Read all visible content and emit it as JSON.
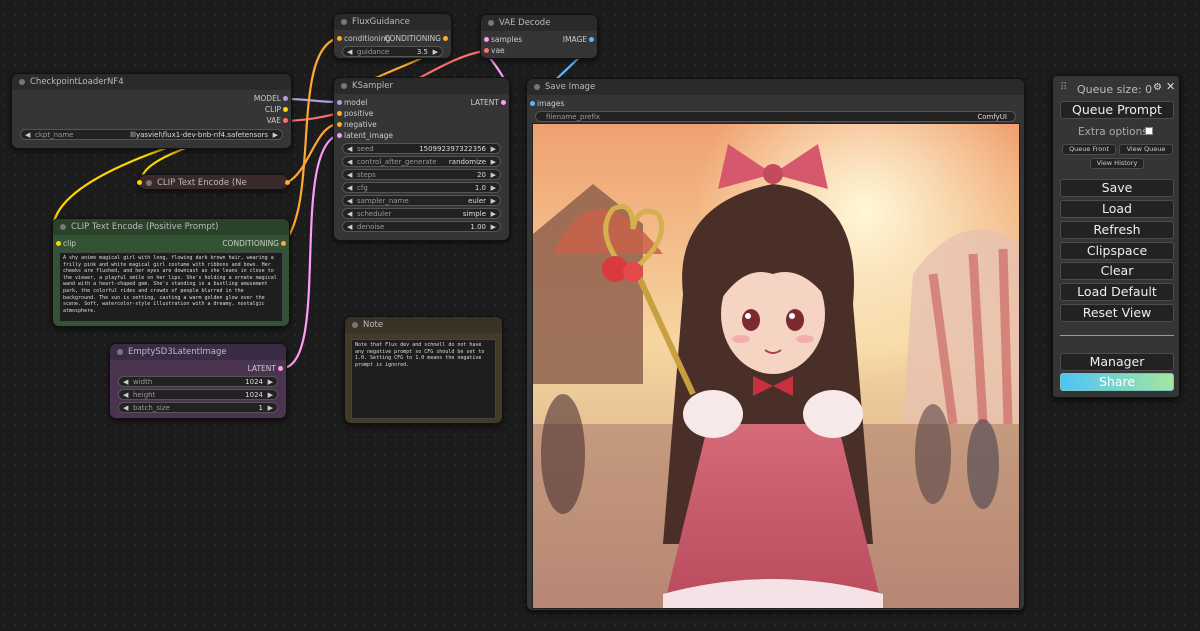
{
  "colors": {
    "model": "#b39ddb",
    "clip": "#ffd500",
    "vae": "#ff6e6e",
    "conditioning": "#ffa931",
    "latent": "#ff9cf9",
    "image": "#64b5f6",
    "share_gradient_start": "#4fc3f7",
    "share_gradient_end": "#a5e6a0"
  },
  "checkpoint_loader": {
    "title": "CheckpointLoaderNF4",
    "outputs": [
      "MODEL",
      "CLIP",
      "VAE"
    ],
    "widget_name": "ckpt_name",
    "widget_value": "lllyasviel\\flux1-dev-bnb-nf4.safetensors"
  },
  "clip_neg": {
    "title": "CLIP Text Encode (Ne"
  },
  "clip_pos": {
    "title": "CLIP Text Encode (Positive Prompt)",
    "input": "clip",
    "output": "CONDITIONING",
    "text": "A shy anime magical girl with long, flowing dark brown hair, wearing a frilly pink and white magical girl costume with ribbons and bows. Her cheeks are flushed, and her eyes are downcast as she leans in close to the viewer, a playful smile on her lips. She's holding a ornate magical wand with a heart-shaped gem. She's standing in a bustling amusement park, the colorful rides and crowds of people blurred in the background. The sun is setting, casting a warm golden glow over the scene. Soft, watercolor-style illustration with a dreamy, nostalgic atmosphere."
  },
  "empty_latent": {
    "title": "EmptySD3LatentImage",
    "output": "LATENT",
    "widgets": [
      {
        "name": "width",
        "value": "1024"
      },
      {
        "name": "height",
        "value": "1024"
      },
      {
        "name": "batch_size",
        "value": "1"
      }
    ]
  },
  "flux_guidance": {
    "title": "FluxGuidance",
    "input": "conditioning",
    "output": "CONDITIONING",
    "widget_name": "guidance",
    "widget_value": "3.5"
  },
  "vae_decode": {
    "title": "VAE Decode",
    "inputs": [
      "samples",
      "vae"
    ],
    "output": "IMAGE"
  },
  "ksampler": {
    "title": "KSampler",
    "inputs": [
      "model",
      "positive",
      "negative",
      "latent_image"
    ],
    "output": "LATENT",
    "widgets": [
      {
        "name": "seed",
        "value": "150992397322356"
      },
      {
        "name": "control_after_generate",
        "value": "randomize"
      },
      {
        "name": "steps",
        "value": "20"
      },
      {
        "name": "cfg",
        "value": "1.0"
      },
      {
        "name": "sampler_name",
        "value": "euler"
      },
      {
        "name": "scheduler",
        "value": "simple"
      },
      {
        "name": "denoise",
        "value": "1.00"
      }
    ]
  },
  "note": {
    "title": "Note",
    "text": "Note that Flux dev and schnell do not have any negative prompt so CFG should be set to 1.0. Setting CFG to 1.0 means the negative prompt is ignored."
  },
  "save_image": {
    "title": "Save Image",
    "input": "images",
    "widget_name": "filename_prefix",
    "widget_value": "ComfyUI"
  },
  "menu": {
    "queue_size": "Queue size: 0",
    "queue_prompt": "Queue Prompt",
    "extra_options": "Extra options",
    "queue_front": "Queue Front",
    "view_queue": "View Queue",
    "view_history": "View History",
    "buttons": [
      "Save",
      "Load",
      "Refresh",
      "Clipspace",
      "Clear",
      "Load Default",
      "Reset View"
    ],
    "manager": "Manager",
    "share": "Share"
  }
}
